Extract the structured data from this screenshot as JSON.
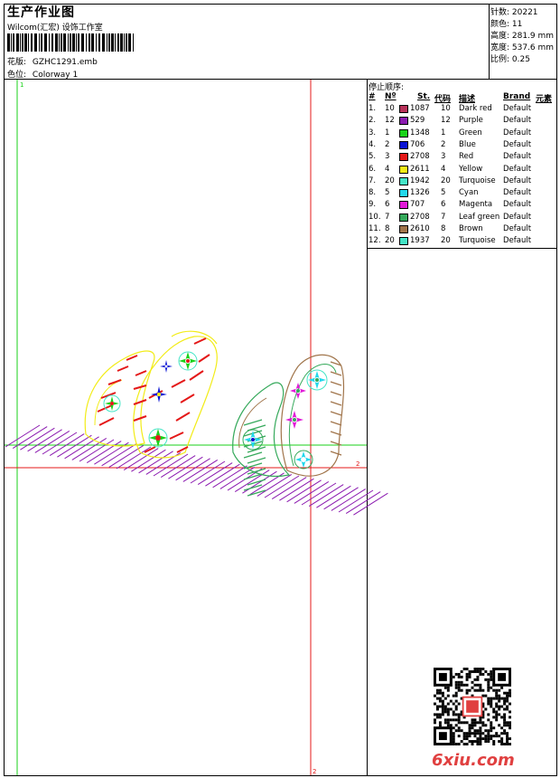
{
  "header": {
    "title": "生产作业图",
    "subtitle": "Wilcom(汇宏) 设饰工作室",
    "design_label": "花版:",
    "design_value": "GZHC1291.emb",
    "colorway_label": "色位:",
    "colorway_value": "Colorway 1"
  },
  "stats": {
    "stitches": "针数: 20221",
    "colors": "颜色: 11",
    "height": "高度: 281.9 mm",
    "width": "宽度: 537.6 mm",
    "scale": "比例: 0.25"
  },
  "stop_table": {
    "caption": "停止顺序:",
    "headers": {
      "num": "#",
      "no": "Nº",
      "st": "St.",
      "code": "代码",
      "desc": "描述",
      "brand": "Brand",
      "element": "元素"
    },
    "rows": [
      {
        "idx": "1.",
        "no": "10",
        "color": "#b8325a",
        "st": "1087",
        "code": "10",
        "desc": "Dark red",
        "brand": "Default"
      },
      {
        "idx": "2.",
        "no": "12",
        "color": "#8b1ab0",
        "st": "529",
        "code": "12",
        "desc": "Purple",
        "brand": "Default"
      },
      {
        "idx": "3.",
        "no": "1",
        "color": "#19d219",
        "st": "1348",
        "code": "1",
        "desc": "Green",
        "brand": "Default"
      },
      {
        "idx": "4.",
        "no": "2",
        "color": "#0a14d4",
        "st": "706",
        "code": "2",
        "desc": "Blue",
        "brand": "Default"
      },
      {
        "idx": "5.",
        "no": "3",
        "color": "#e41818",
        "st": "2708",
        "code": "3",
        "desc": "Red",
        "brand": "Default"
      },
      {
        "idx": "6.",
        "no": "4",
        "color": "#f2ec17",
        "st": "2611",
        "code": "4",
        "desc": "Yellow",
        "brand": "Default"
      },
      {
        "idx": "7.",
        "no": "20",
        "color": "#44e5c7",
        "st": "1942",
        "code": "20",
        "desc": "Turquoise",
        "brand": "Default"
      },
      {
        "idx": "8.",
        "no": "5",
        "color": "#22d8ec",
        "st": "1326",
        "code": "5",
        "desc": "Cyan",
        "brand": "Default"
      },
      {
        "idx": "9.",
        "no": "6",
        "color": "#e21ad8",
        "st": "707",
        "code": "6",
        "desc": "Magenta",
        "brand": "Default"
      },
      {
        "idx": "10.",
        "no": "7",
        "color": "#35a95b",
        "st": "2708",
        "code": "7",
        "desc": "Leaf green",
        "brand": "Default"
      },
      {
        "idx": "11.",
        "no": "8",
        "color": "#a0744a",
        "st": "2610",
        "code": "8",
        "desc": "Brown",
        "brand": "Default"
      },
      {
        "idx": "12.",
        "no": "20",
        "color": "#44e5c7",
        "st": "1937",
        "code": "20",
        "desc": "Turquoise",
        "brand": "Default"
      }
    ]
  },
  "canvas": {
    "marker_top": "1",
    "marker_right": "2",
    "marker_bottom": "2"
  },
  "watermark": "6xiu.com"
}
